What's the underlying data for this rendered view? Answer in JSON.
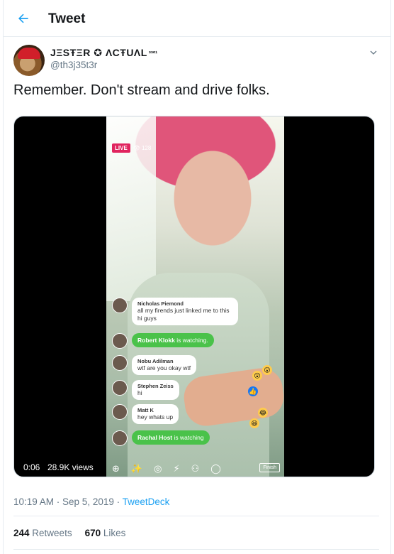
{
  "header": {
    "title": "Tweet",
    "back_icon": "arrow-left-icon"
  },
  "author": {
    "display_name": "JΞSŦΞR ✪ ΛCŦUΛL",
    "name_suffix": "³³º¹",
    "handle": "@th3j35t3r"
  },
  "tweet": {
    "text": "Remember. Don't stream and drive folks."
  },
  "video": {
    "time": "0:06",
    "views": "28.9K views",
    "live_label": "LIVE",
    "viewer_count": "128",
    "comments": [
      {
        "who": "Nicholas Piemond",
        "msg": "all my firends just linked me to this hi guys"
      },
      {
        "joined_name": "Robert Klokk",
        "joined_text": "is watching."
      },
      {
        "who": "Nobu Adilman",
        "msg": "wtf are you okay wtf"
      },
      {
        "who": "Stephen Zeiss",
        "msg": "hi"
      },
      {
        "who": "Matt K",
        "msg": "hey whats up"
      },
      {
        "joined_name": "Rachal Host",
        "joined_text": "is watching"
      }
    ],
    "finish_label": "Finish"
  },
  "meta": {
    "timestamp": "10:19 AM · Sep 5, 2019 · ",
    "source": "TweetDeck"
  },
  "stats": {
    "retweets_count": "244",
    "retweets_label": "Retweets",
    "likes_count": "670",
    "likes_label": "Likes"
  },
  "colors": {
    "accent": "#1da1f2",
    "live_red": "#e0245e",
    "joined_green": "#4ac24a"
  }
}
